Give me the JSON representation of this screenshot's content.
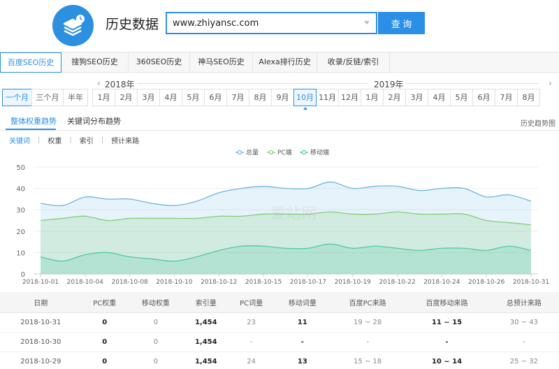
{
  "header": {
    "title": "历史数据",
    "search_value": "www.zhiyansc.com",
    "search_button": "查 询"
  },
  "tabs": [
    {
      "label": "百度SEO历史",
      "active": true
    },
    {
      "label": "搜狗SEO历史",
      "active": false
    },
    {
      "label": "360SEO历史",
      "active": false
    },
    {
      "label": "神马SEO历史",
      "active": false
    },
    {
      "label": "Alexa排行历史",
      "active": false
    },
    {
      "label": "收录/反链/索引",
      "active": false
    }
  ],
  "range_buttons": [
    {
      "label": "一个月",
      "active": true
    },
    {
      "label": "三个月",
      "active": false
    },
    {
      "label": "半年",
      "active": false
    }
  ],
  "years": {
    "left": "2018年",
    "right": "2019年"
  },
  "months": [
    {
      "label": "1月",
      "active": false
    },
    {
      "label": "2月",
      "active": false
    },
    {
      "label": "3月",
      "active": false
    },
    {
      "label": "4月",
      "active": false
    },
    {
      "label": "5月",
      "active": false
    },
    {
      "label": "6月",
      "active": false
    },
    {
      "label": "7月",
      "active": false
    },
    {
      "label": "8月",
      "active": false
    },
    {
      "label": "9月",
      "active": false
    },
    {
      "label": "10月",
      "active": true
    },
    {
      "label": "11月",
      "active": false
    },
    {
      "label": "12月",
      "active": false
    },
    {
      "label": "1月",
      "active": false
    },
    {
      "label": "2月",
      "active": false
    },
    {
      "label": "3月",
      "active": false
    },
    {
      "label": "4月",
      "active": false
    },
    {
      "label": "5月",
      "active": false
    },
    {
      "label": "6月",
      "active": false
    },
    {
      "label": "7月",
      "active": false
    },
    {
      "label": "8月",
      "active": false
    }
  ],
  "subtabs": {
    "trend": "整体权重趋势",
    "keyword_dist": "关键词分布趋势",
    "history_chart": "历史趋势图"
  },
  "filters": [
    "关键词",
    "权重",
    "索引",
    "预计来路"
  ],
  "watermark": "爱站网",
  "chart_data": {
    "type": "area",
    "ylim": [
      0,
      50
    ],
    "yticks": [
      0,
      10,
      20,
      30,
      40,
      50
    ],
    "x_tick_labels": [
      "2018-10-01",
      "2018-10-04",
      "2018-10-08",
      "2018-10-10",
      "2018-10-12",
      "2018-10-15",
      "2018-10-17",
      "2018-10-19",
      "2018-10-22",
      "2018-10-24",
      "2018-10-26",
      "2018-10-31"
    ],
    "series": [
      {
        "name": "总量",
        "color": "#6bb5de",
        "values": [
          33,
          32,
          36,
          35,
          35,
          33,
          32,
          34,
          38,
          40,
          41,
          40,
          40,
          43,
          40,
          41,
          41,
          39,
          40,
          40,
          36,
          37,
          34
        ]
      },
      {
        "name": "PC端",
        "color": "#80cf78",
        "values": [
          25,
          26,
          27,
          25,
          26,
          26,
          26,
          26,
          27,
          27,
          28,
          28,
          28,
          29,
          28,
          28,
          29,
          28,
          28,
          28,
          25,
          24,
          23
        ]
      },
      {
        "name": "移动端",
        "color": "#4ccaa3",
        "values": [
          8,
          6,
          9,
          10,
          8,
          7,
          6,
          8,
          11,
          13,
          13,
          12,
          12,
          14,
          12,
          13,
          12,
          11,
          12,
          12,
          11,
          13,
          11
        ]
      }
    ]
  },
  "table": {
    "headers": [
      "日期",
      "PC权重",
      "移动权重",
      "索引量",
      "PC词量",
      "移动词量",
      "百度PC来路",
      "百度移动来路",
      "总预计来路"
    ],
    "rows": [
      [
        "2018-10-31",
        "0",
        "0",
        "1,454",
        "23",
        "11",
        "19 ~ 28",
        "11 ~ 15",
        "30 ~ 43"
      ],
      [
        "2018-10-30",
        "0",
        "0",
        "1,454",
        "-",
        "-",
        "-",
        "-",
        "-"
      ],
      [
        "2018-10-29",
        "0",
        "0",
        "1,454",
        "24",
        "13",
        "15 ~ 18",
        "10 ~ 14",
        "25 ~ 32"
      ]
    ]
  }
}
